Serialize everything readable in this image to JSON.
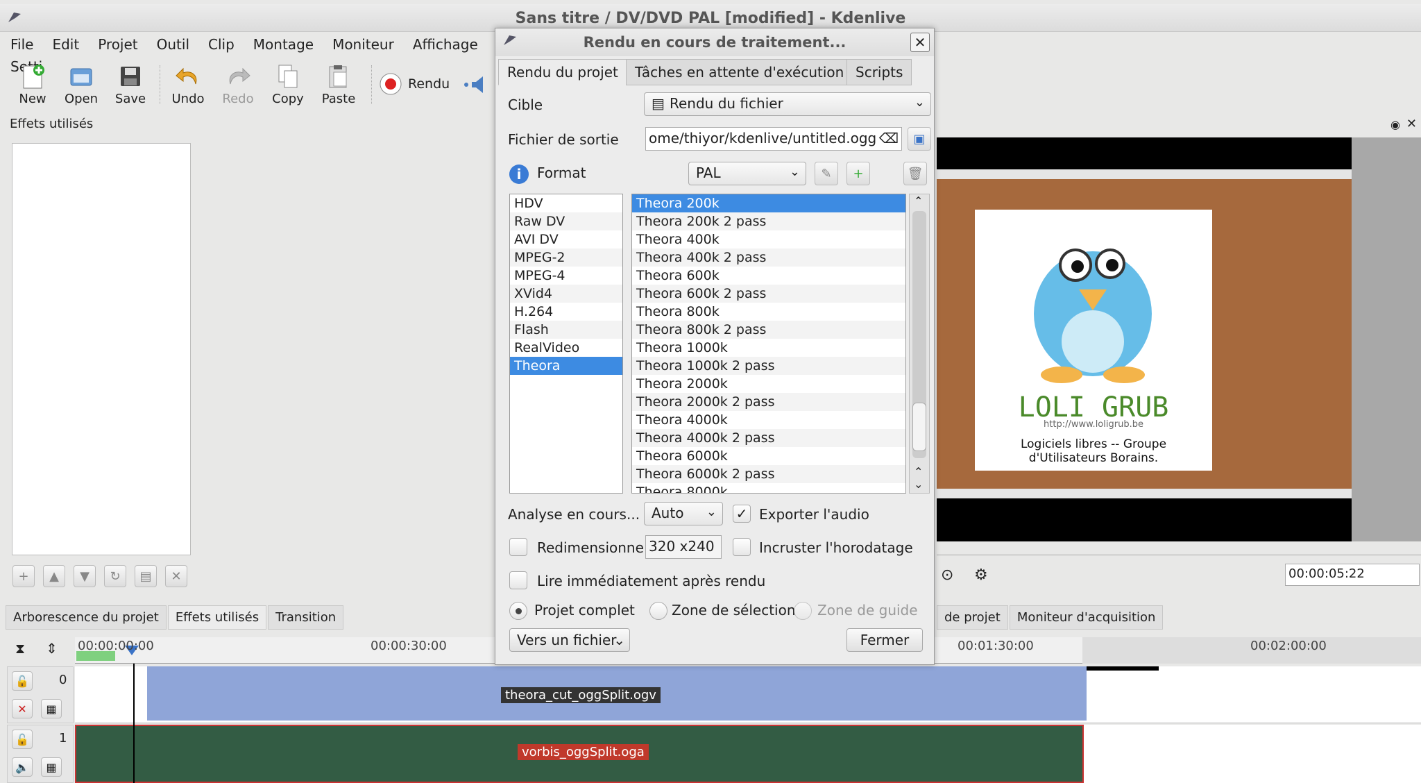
{
  "window": {
    "title": "Sans titre / DV/DVD PAL [modified] - Kdenlive"
  },
  "menu": [
    "File",
    "Edit",
    "Projet",
    "Outil",
    "Clip",
    "Montage",
    "Moniteur",
    "Affichage",
    "Setti"
  ],
  "toolbar": {
    "new": "New",
    "open": "Open",
    "save": "Save",
    "undo": "Undo",
    "redo": "Redo",
    "copy": "Copy",
    "paste": "Paste",
    "render": "Rendu"
  },
  "effects_panel": {
    "title": "Effets utilisés"
  },
  "bottom_tabs": [
    "Arborescence du projet",
    "Effets utilisés",
    "Transition"
  ],
  "bottom_tabs_right": [
    "de projet",
    "Moniteur d'acquisition"
  ],
  "monitor": {
    "timecode": "00:00:05:22",
    "logo_title": "LOLI GRUB",
    "logo_url": "http://www.loligrub.be",
    "logo_caption": "Logiciels libres -- Groupe d'Utilisateurs Borains."
  },
  "timeline": {
    "ruler": [
      "00:00:00:00",
      "00:00:30:00",
      "00:01:30:00",
      "00:02:00:00"
    ],
    "tracks": [
      {
        "number": "0",
        "clip": "theora_cut_oggSplit.ogv"
      },
      {
        "number": "1",
        "clip": "vorbis_oggSplit.oga"
      }
    ]
  },
  "dialog": {
    "title": "Rendu en cours de traitement...",
    "tabs": [
      "Rendu du projet",
      "Tâches en attente d'exécution",
      "Scripts"
    ],
    "target_label": "Cible",
    "target_value": "Rendu du fichier",
    "output_label": "Fichier de sortie",
    "output_value": "ome/thiyor/kdenlive/untitled.ogg",
    "format_label": "Format",
    "format_value": "PAL",
    "formats": [
      "HDV",
      "Raw DV",
      "AVI DV",
      "MPEG-2",
      "MPEG-4",
      "XVid4",
      "H.264",
      "Flash",
      "RealVideo",
      "Theora"
    ],
    "selected_format": "Theora",
    "profiles": [
      "Theora 200k",
      "Theora 200k 2 pass",
      "Theora 400k",
      "Theora 400k 2 pass",
      "Theora 600k",
      "Theora 600k 2 pass",
      "Theora 800k",
      "Theora 800k 2 pass",
      "Theora 1000k",
      "Theora 1000k 2 pass",
      "Theora 2000k",
      "Theora 2000k 2 pass",
      "Theora 4000k",
      "Theora 4000k 2 pass",
      "Theora 6000k",
      "Theora 6000k 2 pass",
      "Theora 8000k"
    ],
    "selected_profile": "Theora 200k",
    "analysis_label": "Analyse en cours...",
    "analysis_value": "Auto",
    "export_audio": "Exporter l'audio",
    "resize_label": "Redimensionne",
    "resize_value": "320 x240",
    "timestamp_label": "Incruster l'horodatage",
    "play_after": "Lire immédiatement après rendu",
    "radio_full": "Projet complet",
    "radio_selection": "Zone de sélection",
    "radio_guide": "Zone de guide",
    "to_file": "Vers un fichier",
    "close": "Fermer"
  }
}
